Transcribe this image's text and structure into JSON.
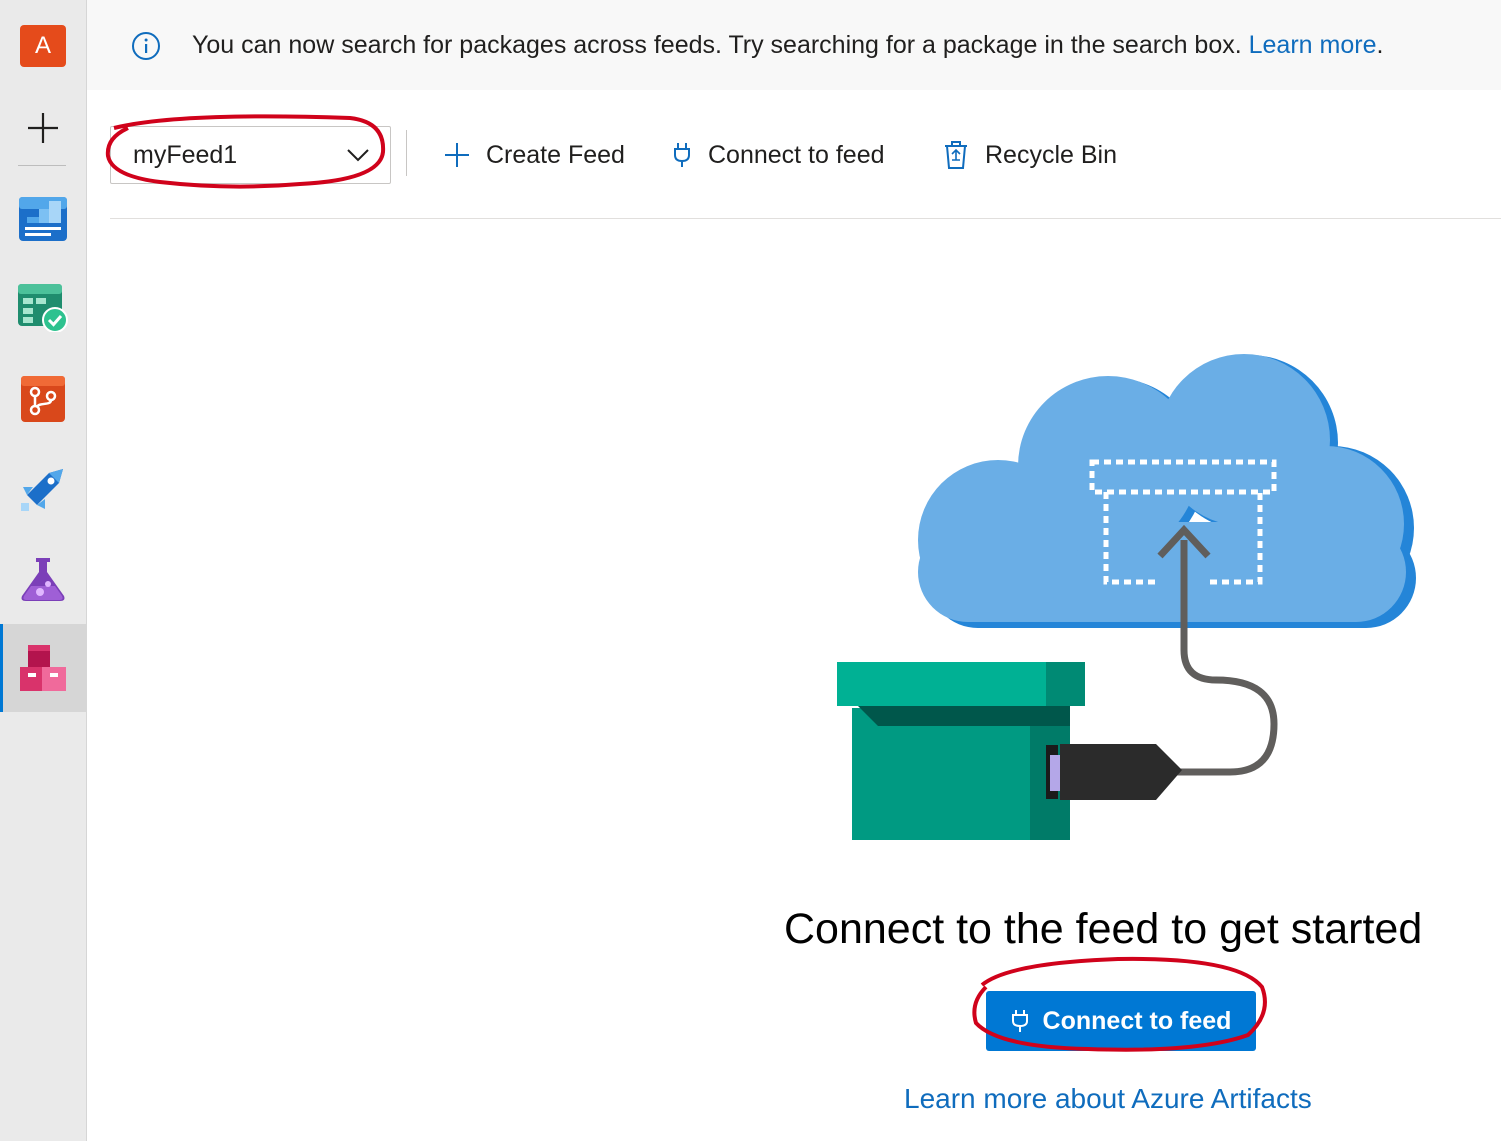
{
  "nav": {
    "org_initial": "A",
    "items": [
      {
        "icon": "overview-icon"
      },
      {
        "icon": "boards-icon"
      },
      {
        "icon": "repos-icon"
      },
      {
        "icon": "pipelines-icon"
      },
      {
        "icon": "test-plans-icon"
      },
      {
        "icon": "artifacts-icon",
        "active": true
      }
    ]
  },
  "banner": {
    "message": "You can now search for packages across feeds. Try searching for a package in the search box. ",
    "link": "Learn more",
    "trailing": "."
  },
  "toolbar": {
    "feed_selected": "myFeed1",
    "create_feed": "Create Feed",
    "connect_to_feed": "Connect to feed",
    "recycle_bin": "Recycle Bin"
  },
  "empty_state": {
    "title": "Connect to the feed to get started",
    "button": "Connect to feed",
    "learn_link": "Learn more about Azure Artifacts"
  },
  "colors": {
    "accent": "#0078d4",
    "annotation": "#d0021b"
  }
}
